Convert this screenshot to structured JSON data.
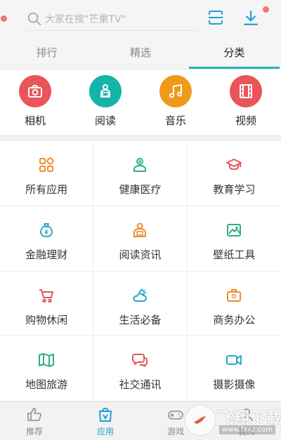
{
  "search": {
    "placeholder": "大家在搜\"芒果TV\""
  },
  "tabs": [
    {
      "label": "排行",
      "active": false
    },
    {
      "label": "精选",
      "active": false
    },
    {
      "label": "分类",
      "active": true
    }
  ],
  "quick_categories": [
    {
      "label": "相机",
      "icon": "camera-icon",
      "color": "#e8555b"
    },
    {
      "label": "阅读",
      "icon": "reader-icon",
      "color": "#16b3aa"
    },
    {
      "label": "音乐",
      "icon": "music-note-icon",
      "color": "#f09a1a"
    },
    {
      "label": "视频",
      "icon": "film-icon",
      "color": "#e8555b"
    }
  ],
  "categories": [
    {
      "label": "所有应用",
      "icon": "apps-grid-icon",
      "color": "#f08c2e"
    },
    {
      "label": "健康医疗",
      "icon": "doctor-icon",
      "color": "#2fae7b"
    },
    {
      "label": "教育学习",
      "icon": "graduation-cap-icon",
      "color": "#e0575b"
    },
    {
      "label": "金融理财",
      "icon": "money-bag-icon",
      "color": "#2aa9c9"
    },
    {
      "label": "阅读资讯",
      "icon": "reading-person-icon",
      "color": "#f08c2e"
    },
    {
      "label": "壁纸工具",
      "icon": "picture-icon",
      "color": "#2fae7b"
    },
    {
      "label": "购物休闲",
      "icon": "shopping-cart-icon",
      "color": "#e0575b"
    },
    {
      "label": "生活必备",
      "icon": "weather-cloud-icon",
      "color": "#2aa9c9"
    },
    {
      "label": "商务办公",
      "icon": "briefcase-icon",
      "color": "#f08c2e"
    },
    {
      "label": "地图旅游",
      "icon": "map-icon",
      "color": "#2fae7b"
    },
    {
      "label": "社交通讯",
      "icon": "chat-bubbles-icon",
      "color": "#e0575b"
    },
    {
      "label": "摄影摄像",
      "icon": "video-camera-icon",
      "color": "#2aa9c9"
    }
  ],
  "bottom_nav": [
    {
      "label": "推荐",
      "icon": "thumbs-up-icon",
      "active": false
    },
    {
      "label": "应用",
      "icon": "app-bag-icon",
      "active": true
    },
    {
      "label": "游戏",
      "icon": "gamepad-icon",
      "active": false
    },
    {
      "label": "我的",
      "icon": "user-icon",
      "active": false
    }
  ],
  "watermark": {
    "title": "飞翔下载",
    "url": "www.fxxz.com"
  },
  "colors": {
    "accent": "#26b5b8",
    "notify_dot": "#f0756a",
    "nav_active": "#1e9fd6"
  }
}
